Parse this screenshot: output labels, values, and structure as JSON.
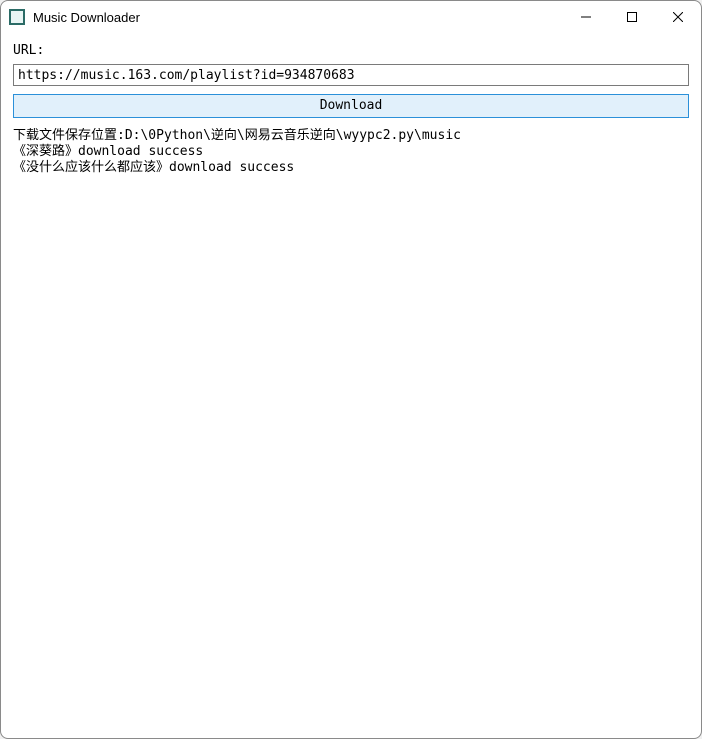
{
  "window": {
    "title": "Music Downloader"
  },
  "form": {
    "url_label": "URL:",
    "url_value": "https://music.163.com/playlist?id=934870683",
    "download_label": "Download"
  },
  "log": {
    "lines": [
      "下载文件保存位置:D:\\0Python\\逆向\\网易云音乐逆向\\wyypc2.py\\music",
      "《深葵路》download success",
      "《没什么应该什么都应该》download success"
    ]
  }
}
